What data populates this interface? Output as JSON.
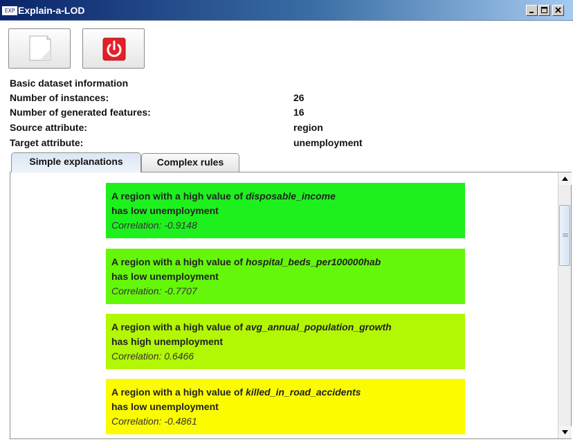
{
  "window": {
    "title": "Explain-a-LOD",
    "icon_text": "EXP"
  },
  "toolbar": {
    "buttons": [
      {
        "name": "new",
        "icon": "blank-document-icon"
      },
      {
        "name": "exit",
        "icon": "power-icon",
        "color": "#e32027"
      }
    ]
  },
  "info": {
    "heading": "Basic dataset information",
    "rows": [
      {
        "label": "Number of instances:",
        "value": "26"
      },
      {
        "label": "Number of generated features:",
        "value": "16"
      },
      {
        "label": "Source attribute:",
        "value": "region"
      },
      {
        "label": "Target attribute:",
        "value": "unemployment"
      }
    ]
  },
  "tabs": [
    {
      "label": "Simple explanations",
      "active": true
    },
    {
      "label": "Complex rules",
      "active": false
    }
  ],
  "explanations": [
    {
      "prefix": "A region with a high value of ",
      "attribute": "disposable_income",
      "line2": "has low unemployment",
      "correlation": "Correlation: -0.9148",
      "color": "#1ef01e"
    },
    {
      "prefix": "A region with a high value of ",
      "attribute": "hospital_beds_per100000hab",
      "line2": "has low unemployment",
      "correlation": "Correlation: -0.7707",
      "color": "#65f70a"
    },
    {
      "prefix": "A region with a high value of ",
      "attribute": "avg_annual_population_growth",
      "line2": "has high unemployment",
      "correlation": "Correlation: 0.6466",
      "color": "#b2f704"
    },
    {
      "prefix": "A region with a high value of ",
      "attribute": "killed_in_road_accidents",
      "line2": "has low unemployment",
      "correlation": "Correlation: -0.4861",
      "color": "#fcfc00"
    }
  ]
}
